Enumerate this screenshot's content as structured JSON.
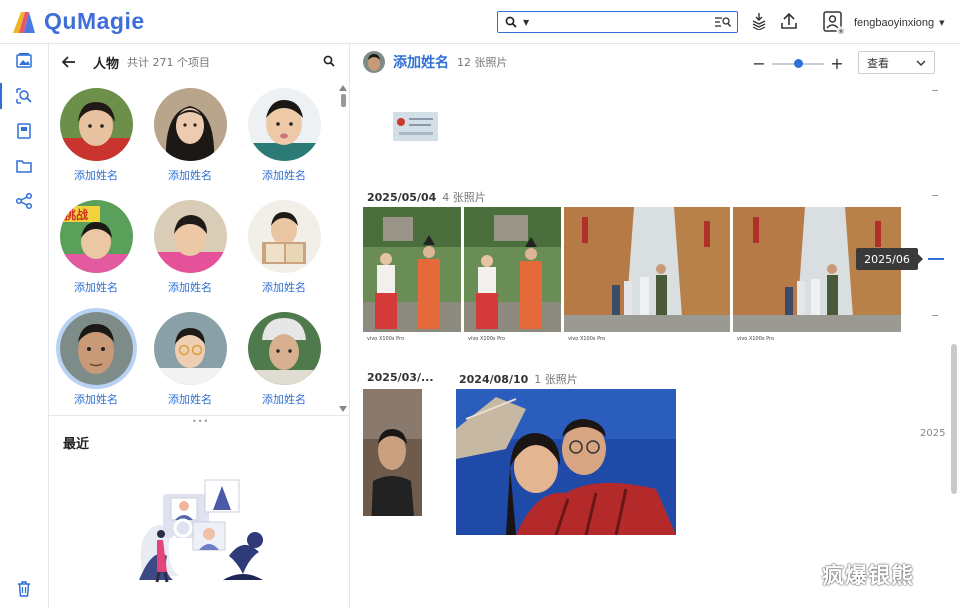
{
  "app": {
    "name": "QuMagie",
    "brand_color": "#3f6ed8",
    "accent": "#2f6fd6"
  },
  "topbar": {
    "search_placeholder": "",
    "username": "fengbaoyinxiong",
    "icons": [
      "search-icon",
      "advanced-search-icon",
      "stack-icon",
      "upload-icon",
      "user-icon"
    ]
  },
  "rail": {
    "items": [
      {
        "name": "photos",
        "icon": "photos-icon"
      },
      {
        "name": "ai-search",
        "icon": "ai-search-icon",
        "active": true
      },
      {
        "name": "albums",
        "icon": "album-icon"
      },
      {
        "name": "folders",
        "icon": "folder-icon"
      },
      {
        "name": "share",
        "icon": "share-icon"
      },
      {
        "name": "trash",
        "icon": "trash-icon"
      }
    ]
  },
  "people": {
    "title": "人物",
    "count": "共计 271 个项目",
    "items": [
      {
        "name": "添加姓名"
      },
      {
        "name": "添加姓名"
      },
      {
        "name": "添加姓名"
      },
      {
        "name": "添加姓名"
      },
      {
        "name": "添加姓名"
      },
      {
        "name": "添加姓名"
      },
      {
        "name": "添加姓名",
        "selected": true
      },
      {
        "name": "添加姓名"
      },
      {
        "name": "添加姓名"
      }
    ],
    "recent_title": "最近"
  },
  "main": {
    "title": "添加姓名",
    "count": "12 张照片",
    "zoom_level": 0.5,
    "view_label": "查看",
    "groups": [
      {
        "date": "2025/05/04",
        "count": "4 张照片"
      },
      {
        "date": "2025/03/...",
        "count": ""
      },
      {
        "date": "2024/08/10",
        "count": "1 张照片"
      }
    ],
    "photo_captions": [
      "vivo X100s Pro",
      "vivo X100s Pro",
      "vivo X100s Pro",
      "vivo X100s Pro"
    ]
  },
  "timeline": {
    "tooltip": "2025/06",
    "year": "2025"
  },
  "watermark": "疯爆银熊"
}
